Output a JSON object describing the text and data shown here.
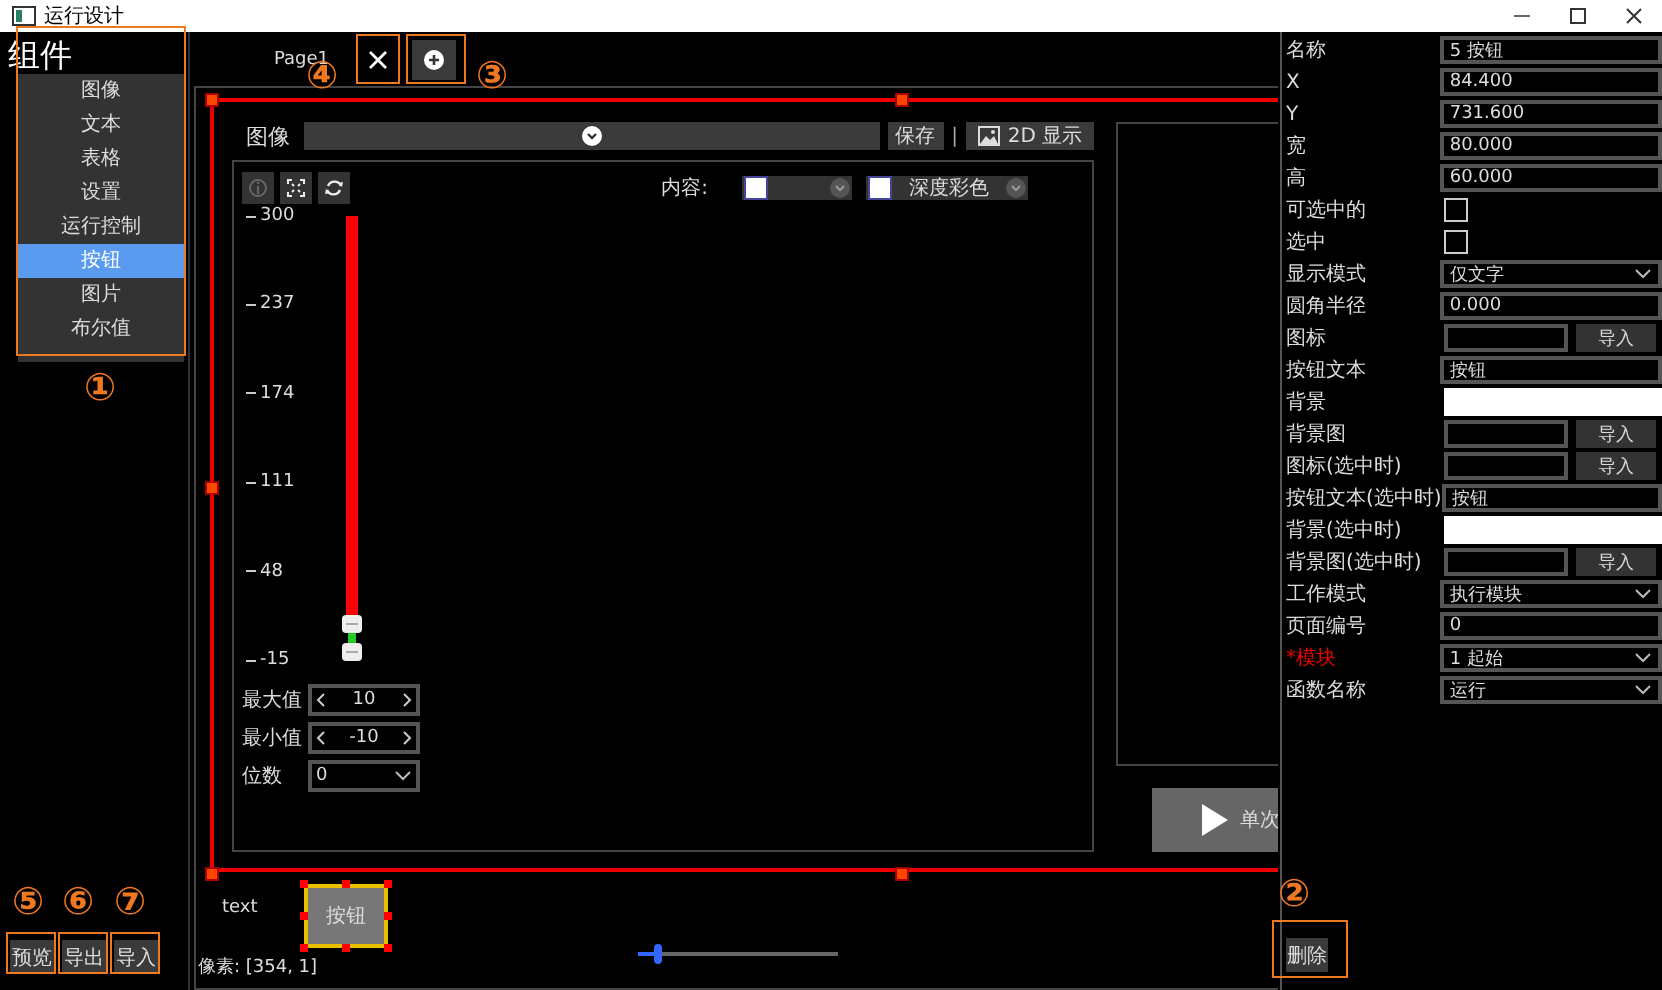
{
  "window": {
    "title": "运行设计"
  },
  "components": {
    "title": "组件",
    "items": [
      {
        "label": "图像",
        "selected": false
      },
      {
        "label": "文本",
        "selected": false
      },
      {
        "label": "表格",
        "selected": false
      },
      {
        "label": "设置",
        "selected": false
      },
      {
        "label": "运行控制",
        "selected": false
      },
      {
        "label": "按钮",
        "selected": true
      },
      {
        "label": "图片",
        "selected": false
      },
      {
        "label": "布尔值",
        "selected": false
      }
    ]
  },
  "left_buttons": [
    {
      "label": "预览"
    },
    {
      "label": "导出"
    },
    {
      "label": "导入"
    }
  ],
  "page_tabs": [
    {
      "label": "Page1"
    }
  ],
  "canvas": {
    "image_widget": {
      "label": "图像",
      "save": "保存",
      "separator": "|",
      "display_button": "2D 显示",
      "content_label": "内容:",
      "toolbar": [
        {
          "kind": "info",
          "disabled": true
        },
        {
          "kind": "fit",
          "disabled": false
        },
        {
          "kind": "refresh",
          "disabled": false
        }
      ],
      "content_selects": [
        {
          "kind": "swatch"
        },
        {
          "kind": "swatch",
          "value": "深度彩色"
        }
      ],
      "scale_ticks": [
        "300",
        "237",
        "174",
        "111",
        "48",
        "-15"
      ],
      "settings": [
        {
          "label": "最大值",
          "kind": "spinner",
          "value": "10"
        },
        {
          "label": "最小值",
          "kind": "spinner",
          "value": "-10"
        },
        {
          "label": "位数",
          "kind": "select",
          "value": "0"
        }
      ]
    },
    "run_button": {
      "label": "单次"
    },
    "text_label": "text",
    "pixel_readout": "像素: [354, 1]",
    "placed_button": {
      "label": "按钮",
      "selected": true
    },
    "zoom_slider": {
      "level": 0.1
    }
  },
  "properties": [
    {
      "label": "名称",
      "kind": "text",
      "value": "5 按钮"
    },
    {
      "label": "X",
      "kind": "text",
      "value": "84.400"
    },
    {
      "label": "Y",
      "kind": "text",
      "value": "731.600"
    },
    {
      "label": "宽",
      "kind": "text",
      "value": "80.000"
    },
    {
      "label": "高",
      "kind": "text",
      "value": "60.000"
    },
    {
      "label": "可选中的",
      "kind": "checkbox",
      "checked": false
    },
    {
      "label": "选中",
      "kind": "checkbox",
      "checked": false
    },
    {
      "label": "显示模式",
      "kind": "select",
      "value": "仅文字"
    },
    {
      "label": "圆角半径",
      "kind": "text",
      "value": "0.000"
    },
    {
      "label": "图标",
      "kind": "file",
      "button": "导入"
    },
    {
      "label": "按钮文本",
      "kind": "text",
      "value": "按钮"
    },
    {
      "label": "背景",
      "kind": "color",
      "color": "#ffffff"
    },
    {
      "label": "背景图",
      "kind": "file",
      "button": "导入"
    },
    {
      "label": "图标(选中时)",
      "kind": "file",
      "button": "导入"
    },
    {
      "label": "按钮文本(选中时)",
      "kind": "text",
      "value": "按钮"
    },
    {
      "label": "背景(选中时)",
      "kind": "color",
      "color": "#ffffff"
    },
    {
      "label": "背景图(选中时)",
      "kind": "file",
      "button": "导入"
    },
    {
      "label": "工作模式",
      "kind": "select",
      "value": "执行模块"
    },
    {
      "label": "页面编号",
      "kind": "text",
      "value": "0"
    },
    {
      "label": "*模块",
      "kind": "select",
      "value": "1 起始",
      "required": true
    },
    {
      "label": "函数名称",
      "kind": "select",
      "value": "运行"
    }
  ],
  "delete_button": {
    "label": "删除"
  },
  "annotations": [
    {
      "number": "①",
      "kind": "components"
    },
    {
      "number": "②",
      "kind": "delete"
    },
    {
      "number": "③",
      "kind": "add"
    },
    {
      "number": "④",
      "kind": "close"
    },
    {
      "number": "⑤",
      "kind": "preview"
    },
    {
      "number": "⑥",
      "kind": "export"
    },
    {
      "number": "⑦",
      "kind": "import"
    }
  ]
}
